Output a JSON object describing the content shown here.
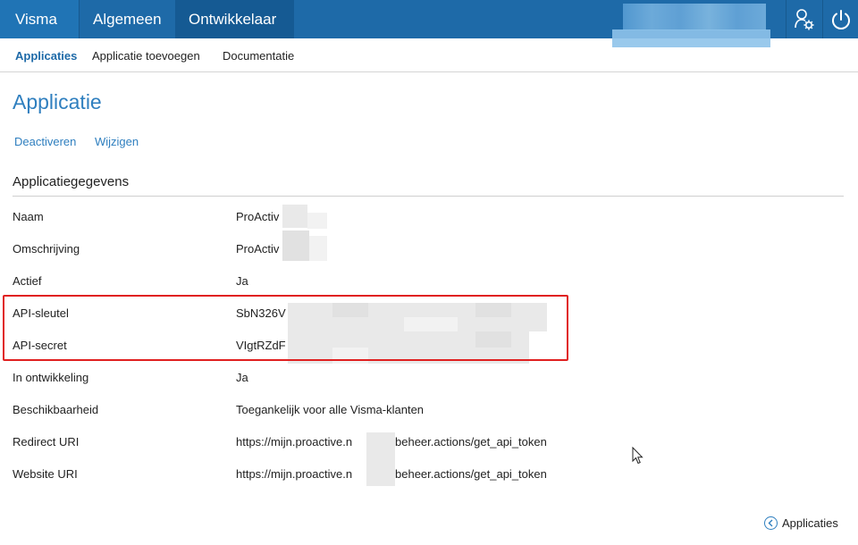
{
  "topnav": {
    "brand": "Visma",
    "items": [
      {
        "label": "Algemeen"
      },
      {
        "label": "Ontwikkelaar"
      }
    ],
    "icons": [
      "user-settings-icon",
      "power-icon"
    ],
    "colors": {
      "bar": "#1e6aa8",
      "active": "#155a93"
    }
  },
  "subnav": {
    "items": [
      {
        "label": "Applicaties",
        "active": true
      },
      {
        "label": "Applicatie toevoegen",
        "active": false
      },
      {
        "label": "Documentatie",
        "active": false
      }
    ]
  },
  "page": {
    "title": "Applicatie",
    "actions": [
      {
        "label": "Deactiveren"
      },
      {
        "label": "Wijzigen"
      }
    ],
    "section_title": "Applicatiegegevens"
  },
  "details": [
    {
      "label": "Naam",
      "value": "ProActiv"
    },
    {
      "label": "Omschrijving",
      "value": "ProActiv"
    },
    {
      "label": "Actief",
      "value": "Ja"
    },
    {
      "label": "API-sleutel",
      "value": "SbN326V"
    },
    {
      "label": "API-secret",
      "value": "VIgtRZdF"
    },
    {
      "label": "In ontwikkeling",
      "value": "Ja"
    },
    {
      "label": "Beschikbaarheid",
      "value": "Toegankelijk voor alle Visma-klanten"
    },
    {
      "label": "Redirect URI",
      "value_start": "https://mijn.proactive.n",
      "value_end": "beheer.actions/get_api_token"
    },
    {
      "label": "Website URI",
      "value_start": "https://mijn.proactive.n",
      "value_end": "beheer.actions/get_api_token"
    }
  ],
  "footer": {
    "back_label": "Applicaties",
    "back_icon": "chevron-left-circle-icon"
  },
  "highlight_color": "#e02020"
}
